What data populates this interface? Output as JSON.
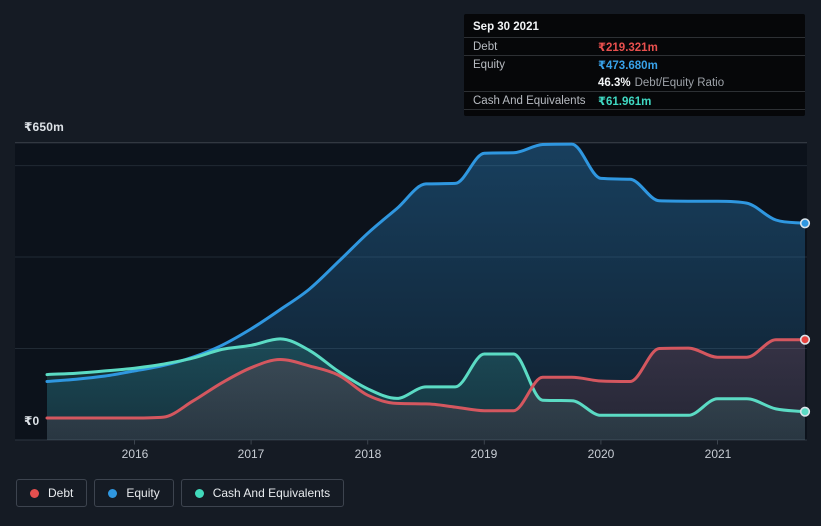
{
  "page": {
    "background": "#151b24"
  },
  "tooltip": {
    "date": "Sep 30 2021",
    "debt_label": "Debt",
    "debt_value": "₹219.321m",
    "equity_label": "Equity",
    "equity_value": "₹473.680m",
    "ratio_value": "46.3%",
    "ratio_label": "Debt/Equity Ratio",
    "cash_label": "Cash And Equivalents",
    "cash_value": "₹61.961m"
  },
  "y_axis": {
    "top_label": "₹650m",
    "zero_label": "₹0"
  },
  "x_axis": {
    "ticks": [
      "2016",
      "2017",
      "2018",
      "2019",
      "2020",
      "2021"
    ]
  },
  "legend": {
    "items": [
      {
        "label": "Debt",
        "color": "#e5504f"
      },
      {
        "label": "Equity",
        "color": "#2f97e0"
      },
      {
        "label": "Cash And Equivalents",
        "color": "#41d9bb"
      }
    ]
  },
  "chart_data": {
    "type": "area",
    "title": "Debt, Equity and Cash over time",
    "unit": "₹ millions (INR)",
    "x_start": 2015.25,
    "x_step": 0.25,
    "x_end": 2021.75,
    "dates": [
      "Mar 2015",
      "Jun 2015",
      "Sep 2015",
      "Dec 2015",
      "Mar 2016",
      "Jun 2016",
      "Sep 2016",
      "Dec 2016",
      "Mar 2017",
      "Jun 2017",
      "Sep 2017",
      "Dec 2017",
      "Mar 2018",
      "Jun 2018",
      "Sep 2018",
      "Dec 2018",
      "Mar 2019",
      "Jun 2019",
      "Sep 2019",
      "Dec 2019",
      "Mar 2020",
      "Jun 2020",
      "Sep 2020",
      "Dec 2020",
      "Mar 2021",
      "Jun 2021",
      "Sep 2021"
    ],
    "series": [
      {
        "name": "Debt",
        "color": "#d4575f",
        "marker_color": "#e8433f",
        "fill_rgb": "212,87,95",
        "values": [
          48,
          48,
          48,
          48,
          50,
          85,
          125,
          158,
          176,
          162,
          142,
          98,
          80,
          79,
          72,
          64,
          64,
          137,
          137,
          129,
          128,
          200,
          201,
          181,
          181,
          219,
          219.321
        ]
      },
      {
        "name": "Equity",
        "color": "#2f97e0",
        "marker_color": "#2f97e0",
        "fill_rgb": "47,151,224",
        "values": [
          128,
          133,
          140,
          151,
          163,
          181,
          207,
          243,
          285,
          330,
          390,
          452,
          506,
          560,
          561,
          627,
          628,
          646,
          647,
          572,
          570,
          523,
          522,
          522,
          518,
          481,
          473.68
        ]
      },
      {
        "name": "Cash And Equivalents",
        "color": "#5bdbc4",
        "marker_color": "#5bdbc4",
        "fill_rgb": "70,217,192",
        "values": [
          143,
          146,
          151,
          157,
          166,
          179,
          198,
          207,
          221,
          196,
          150,
          112,
          91,
          116,
          116,
          188,
          188,
          87,
          86,
          54,
          54,
          54,
          54,
          90,
          90,
          68,
          61.961
        ]
      }
    ],
    "y_axis": {
      "min": 0,
      "max": 650,
      "gridline_values": [
        650,
        600,
        400,
        200,
        0
      ],
      "labeled": [
        650,
        0
      ]
    },
    "x_tick_years": [
      2016,
      2017,
      2018,
      2019,
      2020,
      2021
    ],
    "legend_position": "bottom-left",
    "latest_point": {
      "date": "Sep 30 2021",
      "debt": 219.321,
      "equity": 473.68,
      "cash": 61.961,
      "debt_equity_ratio_pct": 46.3
    }
  }
}
